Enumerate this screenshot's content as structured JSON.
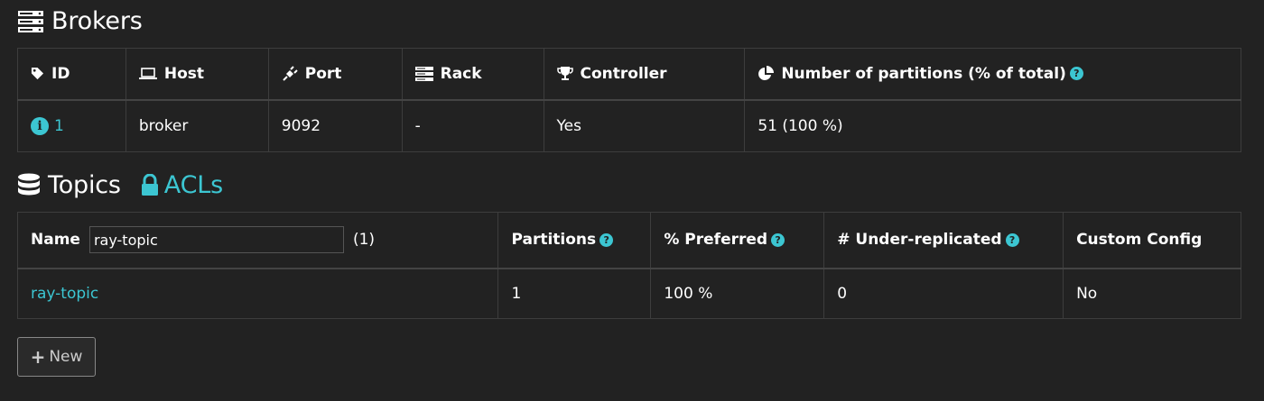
{
  "brokers": {
    "title": "Brokers",
    "icon": "server-icon",
    "columns": {
      "id": "ID",
      "host": "Host",
      "port": "Port",
      "rack": "Rack",
      "controller": "Controller",
      "partitions": "Number of partitions (% of total)"
    },
    "rows": [
      {
        "id": "1",
        "host": "broker",
        "port": "9092",
        "rack": "-",
        "controller": "Yes",
        "partitions": "51 (100 %)"
      }
    ]
  },
  "topics": {
    "title": "Topics",
    "acl_label": "ACLs",
    "columns": {
      "name": "Name",
      "partitions": "Partitions",
      "preferred": "% Preferred",
      "under_replicated": "# Under-replicated",
      "custom_config": "Custom Config"
    },
    "filter_value": "ray-topic",
    "filter_count": "(1)",
    "rows": [
      {
        "name": "ray-topic",
        "partitions": "1",
        "preferred": "100 %",
        "under_replicated": "0",
        "custom_config": "No"
      }
    ]
  },
  "actions": {
    "new_label": "New"
  },
  "colors": {
    "background": "#222222",
    "accent": "#3cc6d2",
    "border": "#3d3d3d"
  }
}
